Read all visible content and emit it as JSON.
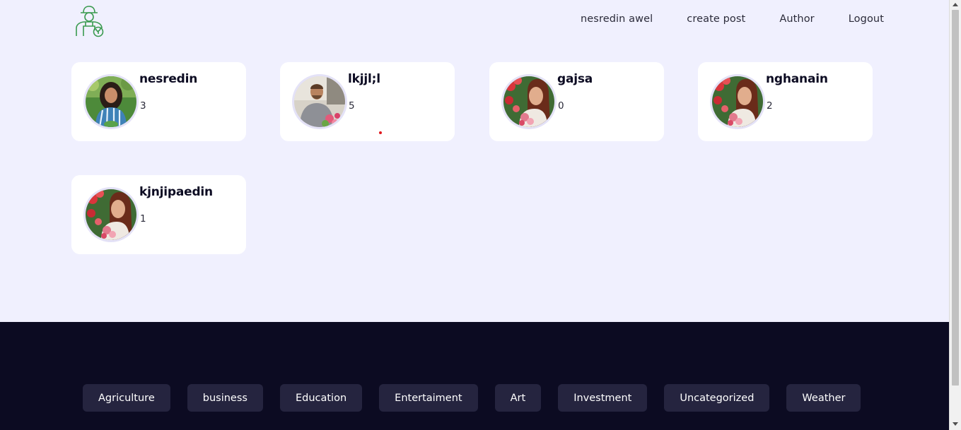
{
  "header": {
    "logo_icon": "farmer-logo-icon",
    "nav": [
      {
        "label": "nesredin awel"
      },
      {
        "label": "create post"
      },
      {
        "label": "Author"
      },
      {
        "label": "Logout"
      }
    ]
  },
  "authors": [
    {
      "name": "nesredin",
      "count": "3",
      "avatar": "woman-striped-shirt"
    },
    {
      "name": "lkjjl;l",
      "count": "5",
      "avatar": "man-gardening"
    },
    {
      "name": "gajsa",
      "count": "0",
      "avatar": "woman-with-flowers"
    },
    {
      "name": "nghanain",
      "count": "2",
      "avatar": "woman-with-flowers"
    },
    {
      "name": "kjnjipaedin",
      "count": "1",
      "avatar": "woman-with-flowers"
    }
  ],
  "footer": {
    "categories": [
      {
        "label": "Agriculture"
      },
      {
        "label": "business"
      },
      {
        "label": "Education"
      },
      {
        "label": "Entertaiment"
      },
      {
        "label": "Art"
      },
      {
        "label": "Investment"
      },
      {
        "label": "Uncategorized"
      },
      {
        "label": "Weather"
      }
    ]
  },
  "colors": {
    "background": "#f0f0fe",
    "footer": "#0c0b22",
    "category_button": "#25243f",
    "logo_green": "#3a9a4f"
  }
}
